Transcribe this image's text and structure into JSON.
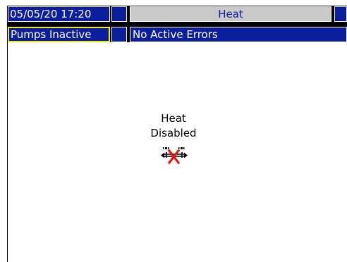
{
  "header": {
    "datetime": "05/05/20 17:20",
    "screen_title": "Heat",
    "pumps_status": "Pumps Inactive",
    "errors_status": "No Active Errors"
  },
  "main": {
    "status_line1": "Heat",
    "status_line2": "Disabled",
    "status_icon": "heat-disabled-icon"
  },
  "colors": {
    "bar_blue": "#0a1e9e",
    "title_gray": "#c9c9c9",
    "highlight_yellow": "#f2e81a",
    "disabled_red": "#e01818"
  }
}
